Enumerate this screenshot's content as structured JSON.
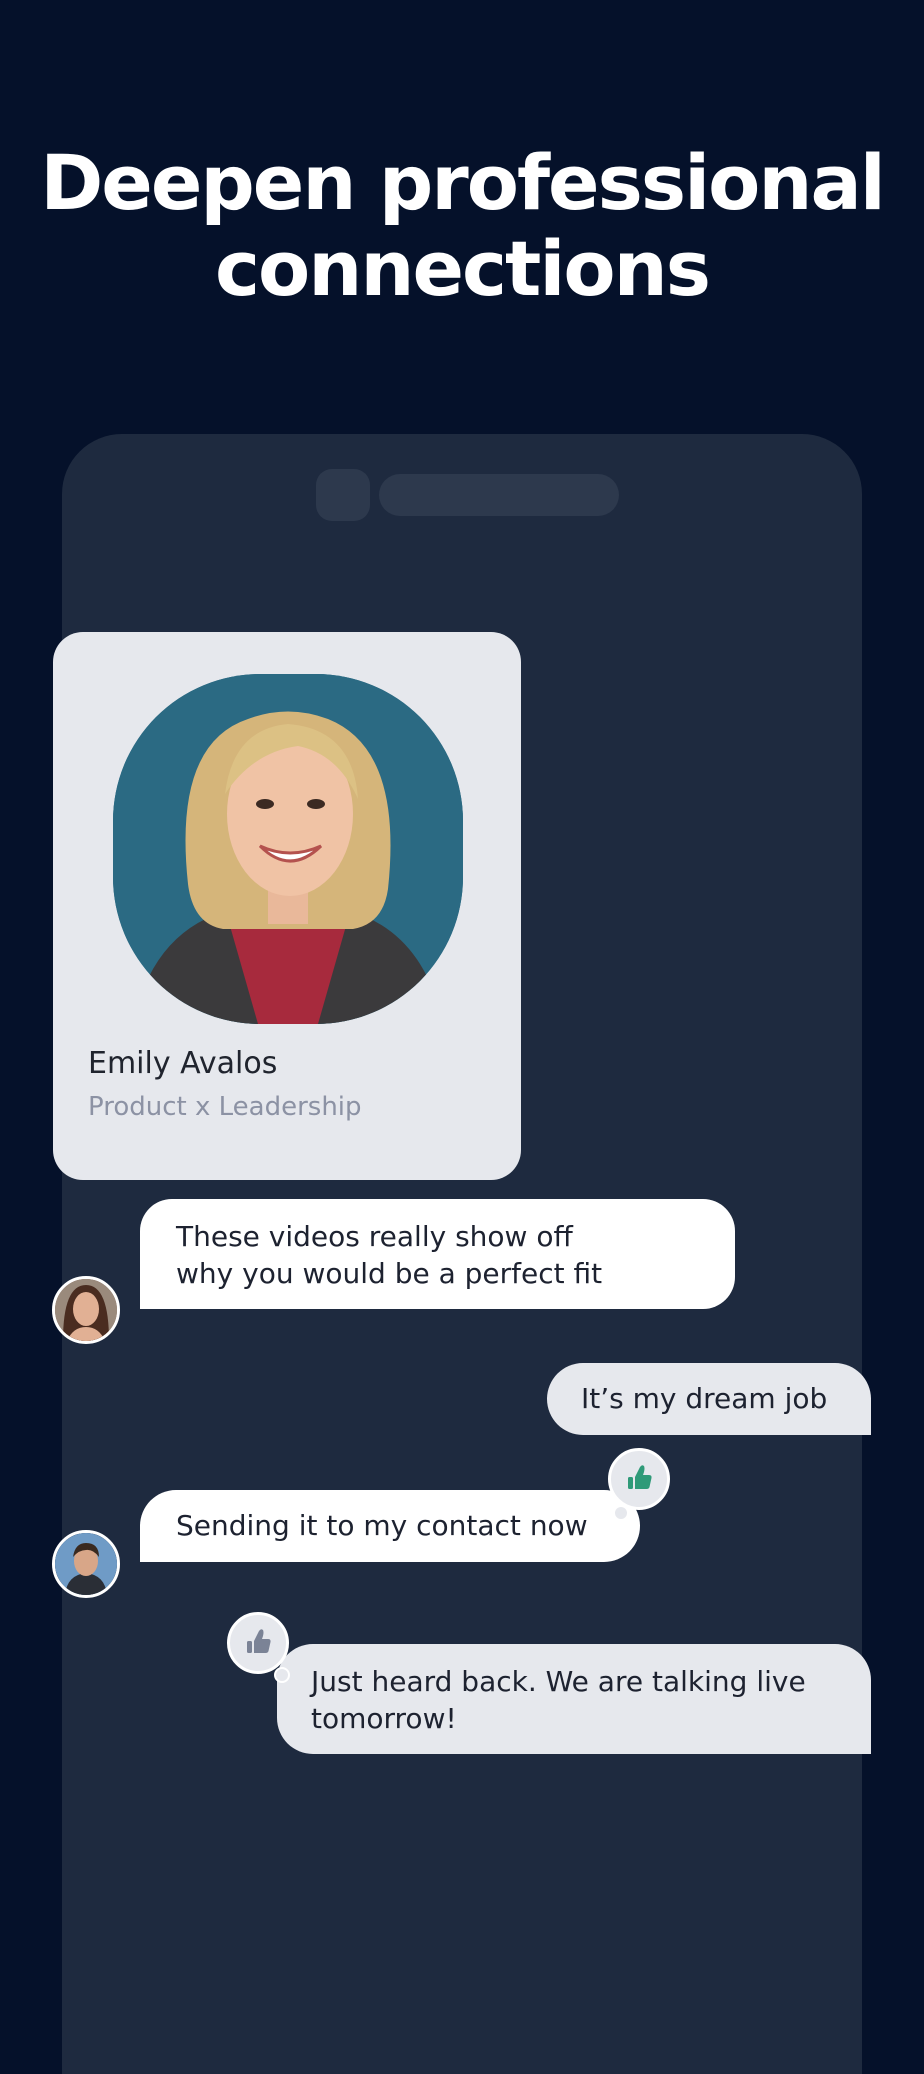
{
  "headline": {
    "line1": "Deepen professional",
    "line2": "connections"
  },
  "profile": {
    "name": "Emily Avalos",
    "role": "Product x Leadership"
  },
  "messages": [
    {
      "line1": "These videos really show off",
      "line2": "why you would be a perfect fit"
    },
    {
      "text": "It’s my dream job"
    },
    {
      "text": "Sending it to my contact now"
    },
    {
      "line1": "Just heard back. We are talking live",
      "line2": "tomorrow!"
    }
  ],
  "colors": {
    "background": "#05112a",
    "phone": "#1e2a3f",
    "card": "#e6e8ed",
    "reaction_green": "#2f9a78",
    "reaction_grey": "#7b8396"
  },
  "icons": {
    "reaction_1": "thumbs-up-icon",
    "reaction_2": "thumbs-up-icon"
  }
}
